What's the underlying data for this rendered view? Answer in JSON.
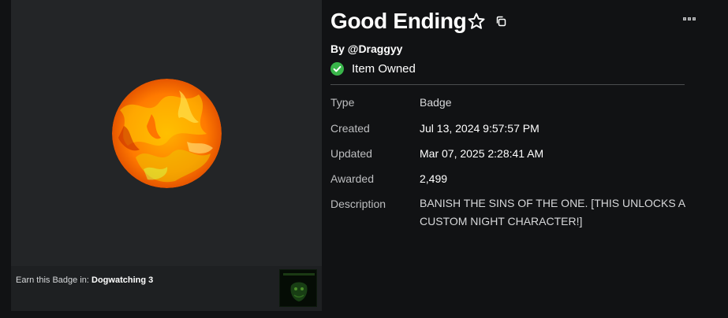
{
  "badge": {
    "title": "Good Ending",
    "byline": "By @Draggyy",
    "owned_label": "Item Owned"
  },
  "details": {
    "type_label": "Type",
    "type_value": "Badge",
    "created_label": "Created",
    "created_value": "Jul 13, 2024 9:57:57 PM",
    "updated_label": "Updated",
    "updated_value": "Mar 07, 2025 2:28:41 AM",
    "awarded_label": "Awarded",
    "awarded_value": "2,499",
    "description_label": "Description",
    "description_value": "BANISH THE SINS OF THE ONE. [THIS UNLOCKS A CUSTOM NIGHT CHARACTER!]"
  },
  "earn": {
    "prefix": "Earn this Badge in: ",
    "game_name": "Dogwatching 3"
  },
  "icons": {
    "favorite": "star-outline-icon",
    "copy": "copy-icon",
    "more": "more-options-icon",
    "owned": "check-circle-icon"
  },
  "colors": {
    "background": "#111214",
    "panel": "#232527",
    "owned_check": "#39b54a",
    "badge_orange": "#ff7a00"
  }
}
